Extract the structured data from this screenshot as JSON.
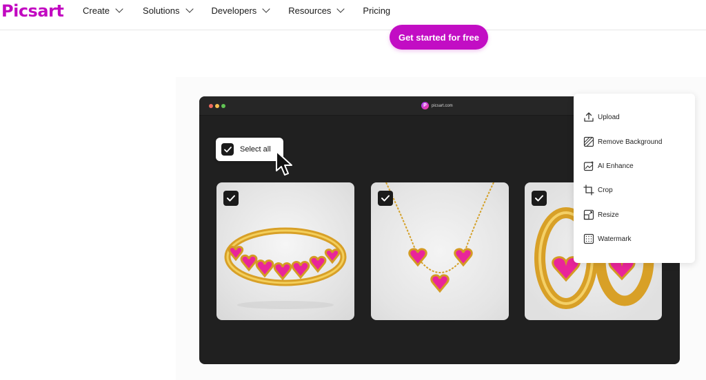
{
  "brand": {
    "logo": "Picsart",
    "accent": "#c20dc4"
  },
  "nav": {
    "items": [
      {
        "label": "Create",
        "dropdown": true
      },
      {
        "label": "Solutions",
        "dropdown": true
      },
      {
        "label": "Developers",
        "dropdown": true
      },
      {
        "label": "Resources",
        "dropdown": true
      },
      {
        "label": "Pricing",
        "dropdown": false
      }
    ]
  },
  "cta": {
    "label": "Get started for free"
  },
  "browser": {
    "url": "picsart.com",
    "url_icon": "P",
    "select_all_label": "Select all",
    "images": [
      {
        "name": "heart-ring",
        "checked": true
      },
      {
        "name": "heart-necklace",
        "checked": true
      },
      {
        "name": "heart-earrings",
        "checked": true
      }
    ]
  },
  "tools_menu": {
    "items": [
      {
        "label": "Upload",
        "icon": "upload-icon"
      },
      {
        "label": "Remove Background",
        "icon": "remove-background-icon"
      },
      {
        "label": "AI Enhance",
        "icon": "ai-enhance-icon"
      },
      {
        "label": "Crop",
        "icon": "crop-icon"
      },
      {
        "label": "Resize",
        "icon": "resize-icon"
      },
      {
        "label": "Watermark",
        "icon": "watermark-icon"
      }
    ]
  }
}
